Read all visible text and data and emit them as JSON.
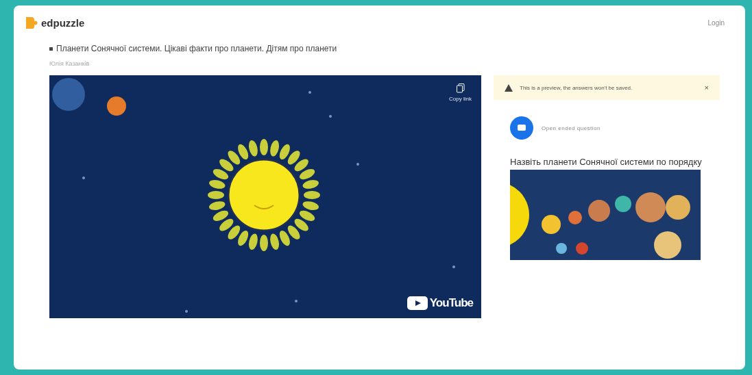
{
  "header": {
    "logo": "edpuzzle",
    "login": "Login"
  },
  "video": {
    "title": "Планети Сонячної системи. Цікаві факти про планети. Дітям про планети",
    "author": "Юлія Казанків",
    "copy_link": "Copy link",
    "youtube": "YouTube"
  },
  "warning": {
    "text": "This is a preview, the answers won't be saved.",
    "close": "×"
  },
  "question": {
    "type": "Open ended question",
    "text": "Назвіть планети Сонячної системи по порядку"
  }
}
